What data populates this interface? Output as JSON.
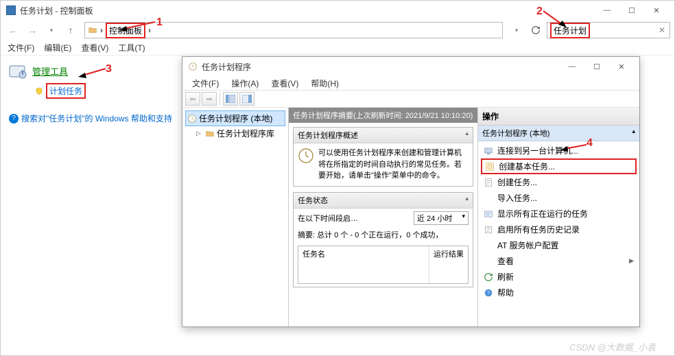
{
  "annotations": {
    "n1": "1",
    "n2": "2",
    "n3": "3",
    "n4": "4"
  },
  "control_panel": {
    "title": "任务计划 - 控制面板",
    "address": {
      "sep": "›",
      "crumb": "控制面板",
      "right_sep": "›"
    },
    "search": {
      "text": "任务计划"
    },
    "menu": {
      "file": "文件(F)",
      "edit": "编辑(E)",
      "view": "查看(V)",
      "tools": "工具(T)"
    },
    "body": {
      "heading": "管理工具",
      "sublink": "计划任务",
      "helplink": "搜索对\"任务计划\"的 Windows 帮助和支持"
    },
    "win_btns": {
      "min": "—",
      "max": "☐",
      "close": "✕"
    }
  },
  "task_scheduler": {
    "title": "任务计划程序",
    "menu": {
      "file": "文件(F)",
      "action": "操作(A)",
      "view": "查看(V)",
      "help": "帮助(H)"
    },
    "tree": {
      "root": "任务计划程序 (本地)",
      "lib": "任务计划程序库"
    },
    "summary_header": "任务计划程序摘要(上次刷新时间: 2021/9/21 10:10:20)",
    "overview": {
      "header": "任务计划程序概述",
      "text": "可以使用任务计划程序来创建和管理计算机将在所指定的时间自动执行的常见任务。若要开始，请单击\"操作\"菜单中的命令。"
    },
    "status": {
      "header": "任务状态",
      "label": "在以下时间段启…",
      "dropdown": "近 24 小时",
      "summary": "摘要: 总计 0 个 - 0 个正在运行，0 个成功，",
      "col1": "任务名",
      "col2": "运行结果"
    },
    "actions": {
      "header": "操作",
      "group": "任务计划程序 (本地)",
      "items": {
        "connect": "连接到另一台计算机...",
        "create_basic": "创建基本任务...",
        "create_task": "创建任务...",
        "import": "导入任务...",
        "show_running": "显示所有正在运行的任务",
        "enable_history": "启用所有任务历史记录",
        "at_config": "AT 服务帐户配置",
        "view": "查看",
        "refresh": "刷新",
        "help": "帮助"
      }
    },
    "win_btns": {
      "min": "—",
      "max": "☐",
      "close": "✕"
    }
  },
  "watermark": "CSDN @大数据_小袁"
}
